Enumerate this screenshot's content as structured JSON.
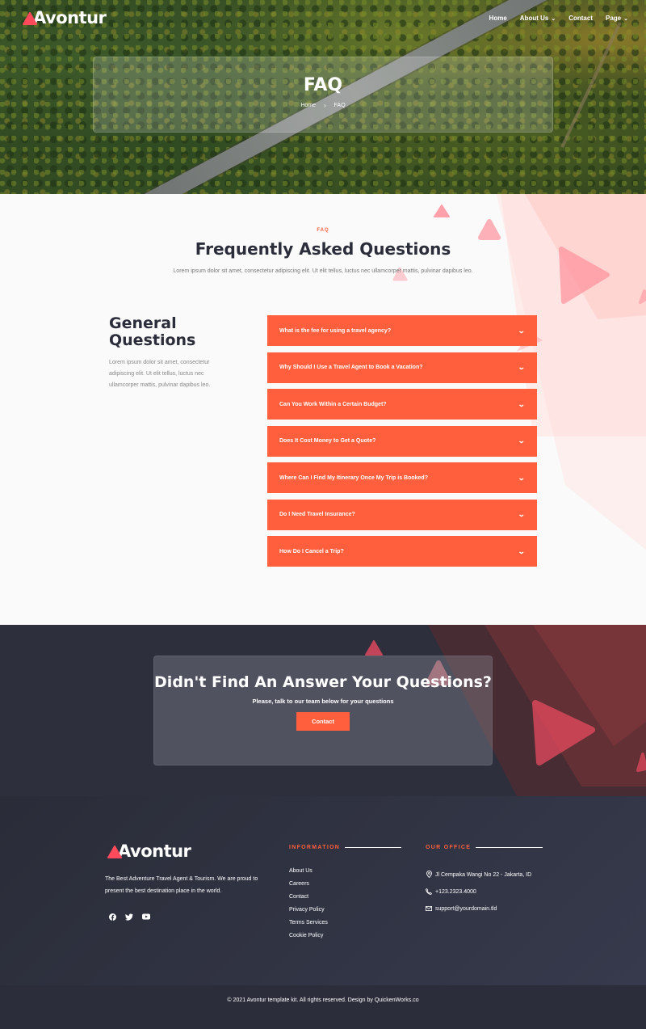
{
  "brand": {
    "name": "Avontur",
    "accent": "#ff5f3c",
    "dark": "#2b2d3a"
  },
  "nav": {
    "items": [
      {
        "label": "Home",
        "has_dropdown": false
      },
      {
        "label": "About Us",
        "has_dropdown": true
      },
      {
        "label": "Contact",
        "has_dropdown": false
      },
      {
        "label": "Page",
        "has_dropdown": true
      }
    ]
  },
  "hero": {
    "title": "FAQ",
    "breadcrumb": {
      "home": "Home",
      "separator": ">",
      "current": "FAQ"
    }
  },
  "faq": {
    "kicker": "FAQ",
    "title": "Frequently Asked Questions",
    "lead": "Lorem ipsum dolor sit amet, consectetur adipiscing elit. Ut elit tellus, luctus nec ullamcorper mattis, pulvinar dapibus leo.",
    "general_title": "General Questions",
    "general_text": "Lorem ipsum dolor sit amet, consectetur adipiscing elit. Ut elit tellus, luctus nec ullamcorper mattis, pulvinar dapibus leo.",
    "questions": [
      "What is the fee for using a travel agency?",
      "Why Should I Use a Travel Agent to Book a Vacation?",
      "Can You Work Within a Certain Budget?",
      "Does It Cost Money to Get a Quote?",
      "Where Can I Find My Itinerary Once My Trip is Booked?",
      "Do I Need Travel Insurance?",
      "How Do I Cancel a Trip?"
    ]
  },
  "cta": {
    "title": "Didn't Find An Answer Your Questions?",
    "subtitle": "Please, talk to our team below for your questions",
    "button": "Contact"
  },
  "footer": {
    "about": "The Best Adventure Travel Agent & Tourism. We are proud to present the best destination place in the world.",
    "social": [
      "facebook-icon",
      "twitter-icon",
      "youtube-icon"
    ],
    "information_title": "INFORMATION",
    "information_links": [
      "About Us",
      "Careers",
      "Contact",
      "Privacy Policy",
      "Terms Services",
      "Cookie Policy"
    ],
    "office_title": "OUR OFFICE",
    "office": {
      "address": "Jl Cempaka Wangi No 22 - Jakarta, ID",
      "phone": "+123.2323.4000",
      "email": "support@yourdomain.tld"
    },
    "copyright": "© 2021 Avontur template kit. All rights reserved. Design by QuickenWorks.co"
  }
}
